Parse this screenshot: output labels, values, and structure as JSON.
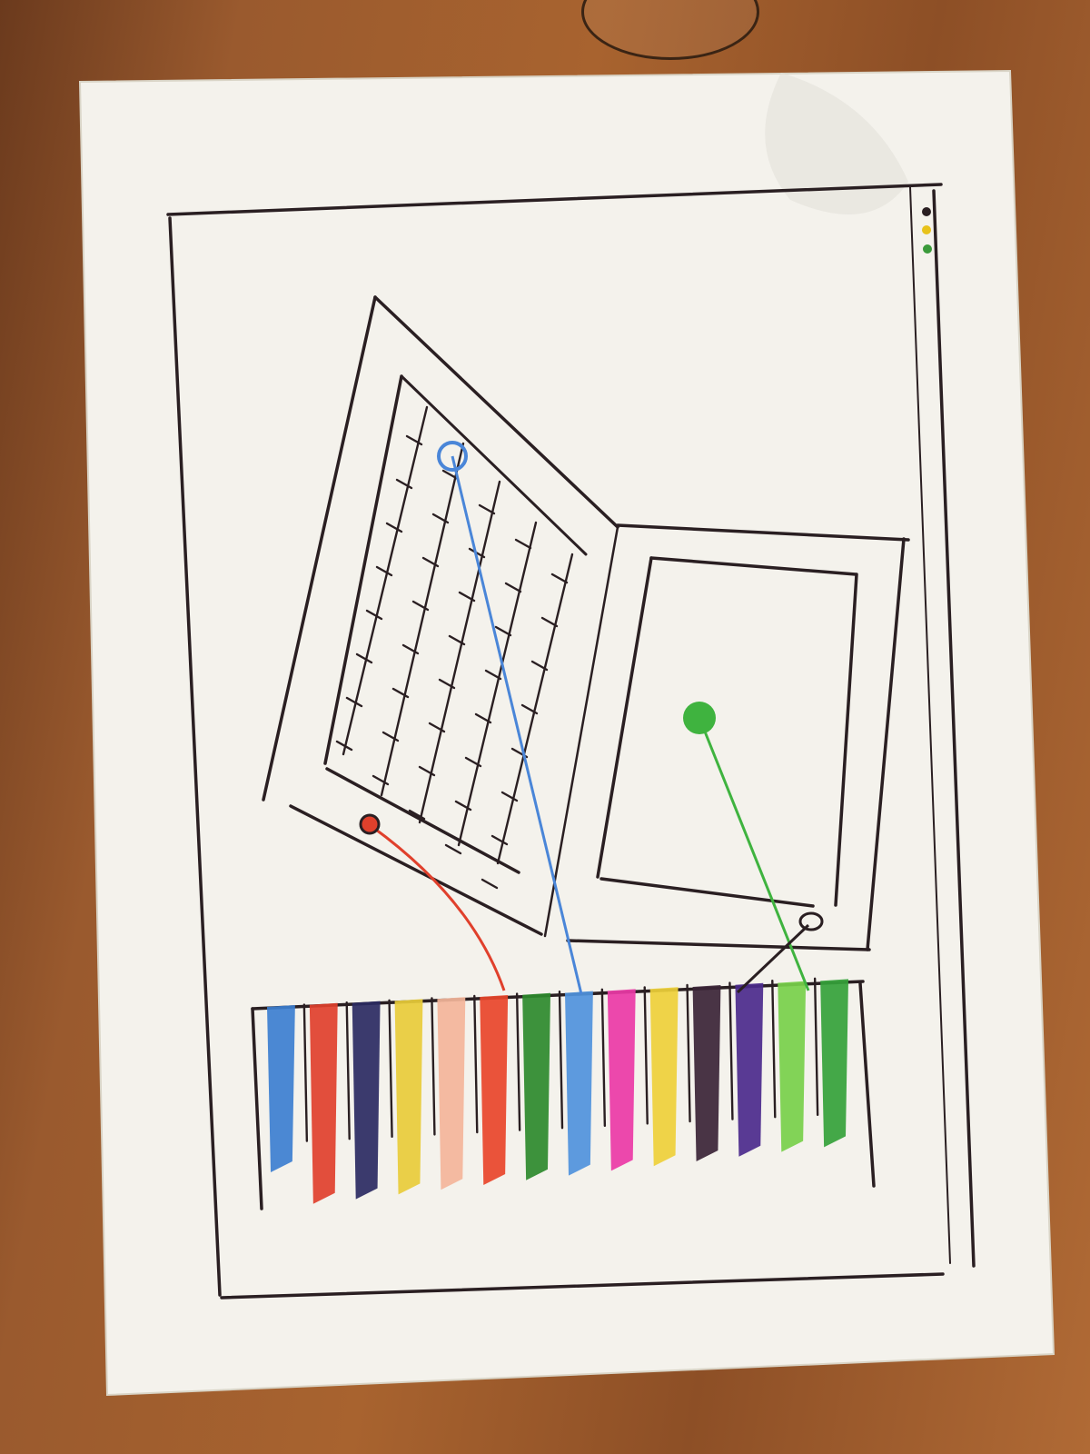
{
  "window": {
    "controls": [
      {
        "name": "close-dot",
        "color": "#2a1f22"
      },
      {
        "name": "minimize-dot",
        "color": "#e8c21a"
      },
      {
        "name": "maximize-dot",
        "color": "#3a9a3a"
      }
    ]
  },
  "pointers": {
    "blue": "#4a86d8",
    "red": "#e0402c",
    "green": "#3fb33f",
    "dark": "#2a1f22"
  },
  "palette": {
    "swatches": [
      {
        "icon": "blue-swatch",
        "color": "#3c7fd0"
      },
      {
        "icon": "red-swatch",
        "color": "#e0402c"
      },
      {
        "icon": "navy-swatch",
        "color": "#2a2a62"
      },
      {
        "icon": "yellow-swatch",
        "color": "#e8cc3a"
      },
      {
        "icon": "peach-swatch",
        "color": "#f3b59a"
      },
      {
        "icon": "orange-red-swatch",
        "color": "#e8452a"
      },
      {
        "icon": "green-swatch",
        "color": "#2c8a2c"
      },
      {
        "icon": "light-blue-swatch",
        "color": "#4f93dc"
      },
      {
        "icon": "pink-swatch",
        "color": "#ea3aa6"
      },
      {
        "icon": "gold-swatch",
        "color": "#eed03a"
      },
      {
        "icon": "dark-purple-swatch",
        "color": "#3a2436"
      },
      {
        "icon": "purple-swatch",
        "color": "#4b2a8c"
      },
      {
        "icon": "lime-swatch",
        "color": "#77d04a"
      },
      {
        "icon": "forest-swatch",
        "color": "#34a23a"
      }
    ]
  }
}
